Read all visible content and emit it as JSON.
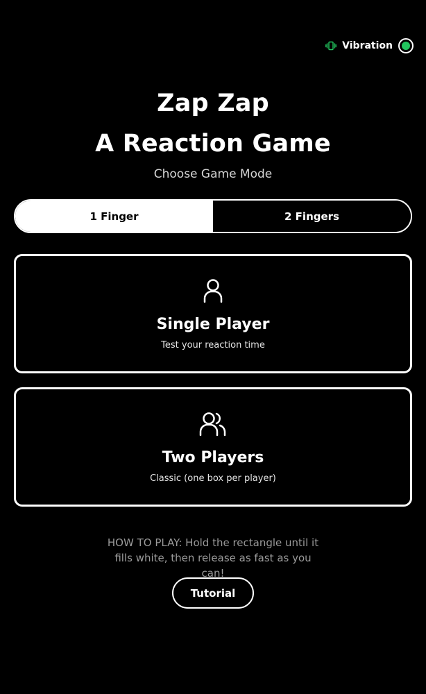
{
  "vibration": {
    "label": "Vibration",
    "icon": "vibration-icon",
    "enabled": true,
    "accent_color": "#22c55e"
  },
  "header": {
    "title_line1": "Zap Zap",
    "title_line2": "A Reaction Game",
    "subtitle": "Choose Game Mode"
  },
  "mode_toggle": {
    "options": [
      {
        "label": "1 Finger",
        "selected": true
      },
      {
        "label": "2 Fingers",
        "selected": false
      }
    ]
  },
  "modes": [
    {
      "icon": "user-icon",
      "title": "Single Player",
      "description": "Test your reaction time"
    },
    {
      "icon": "users-icon",
      "title": "Two Players",
      "description": "Classic (one box per player)"
    }
  ],
  "howto": {
    "text": "HOW TO PLAY: Hold the rectangle until it fills white, then release as fast as you can!"
  },
  "tutorial": {
    "label": "Tutorial"
  }
}
